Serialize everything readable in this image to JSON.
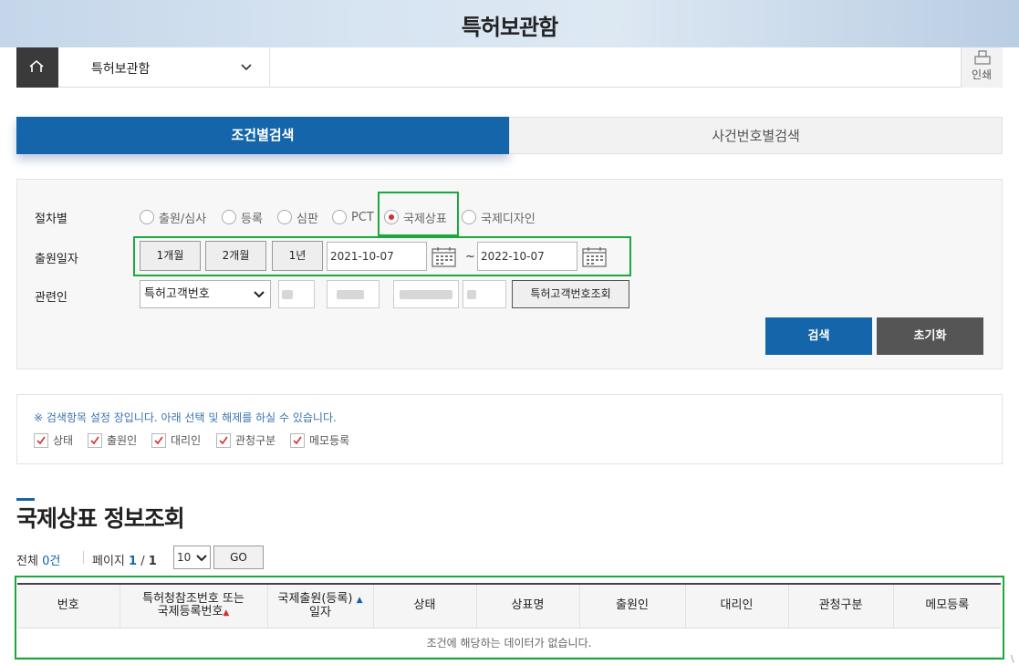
{
  "page_title": "특허보관함",
  "nav": {
    "selected": "특허보관함",
    "print_label": "인쇄"
  },
  "tabs": [
    {
      "label": "조건별검색",
      "active": true
    },
    {
      "label": "사건번호별검색",
      "active": false
    }
  ],
  "search": {
    "procedure_label": "절차별",
    "procedures": [
      {
        "label": "출원/심사",
        "checked": false
      },
      {
        "label": "등록",
        "checked": false
      },
      {
        "label": "심판",
        "checked": false
      },
      {
        "label": "PCT",
        "checked": false
      },
      {
        "label": "국제상표",
        "checked": true
      },
      {
        "label": "국제디자인",
        "checked": false
      }
    ],
    "date_label": "출원일자",
    "periods": [
      "1개월",
      "2개월",
      "1년"
    ],
    "date_from": "2021-10-07",
    "date_tilde": "~",
    "date_to": "2022-10-07",
    "related_label": "관련인",
    "related_select": "특허고객번호",
    "lookup_button": "특허고객번호조회",
    "search_button": "검색",
    "reset_button": "초기화"
  },
  "settings": {
    "note": "※ 검색항목 설정 장입니다. 아래 선택 및 해제를 하실 수 있습니다.",
    "items": [
      "상태",
      "출원인",
      "대리인",
      "관청구분",
      "메모등록"
    ]
  },
  "results": {
    "title": "국제상표 정보조회",
    "total_label": "전체",
    "total_count": "0건",
    "page_label": "페이지",
    "page_current": "1",
    "page_sep": "/",
    "page_total": "1",
    "page_size": "10",
    "go_button": "GO",
    "columns": {
      "no": "번호",
      "ref_line1": "특허청참조번호 또는",
      "ref_line2": "국제등록번호",
      "date_line1": "국제출원(등록)",
      "date_line2": "일자",
      "status": "상태",
      "mark_name": "상표명",
      "applicant": "출원인",
      "agent": "대리인",
      "office": "관청구분",
      "memo": "메모등록"
    },
    "empty_message": "조건에 해당하는 데이터가 없습니다."
  },
  "colors": {
    "primary": "#1565ab",
    "highlight": "#1ba83c",
    "dark_button": "#555555"
  }
}
